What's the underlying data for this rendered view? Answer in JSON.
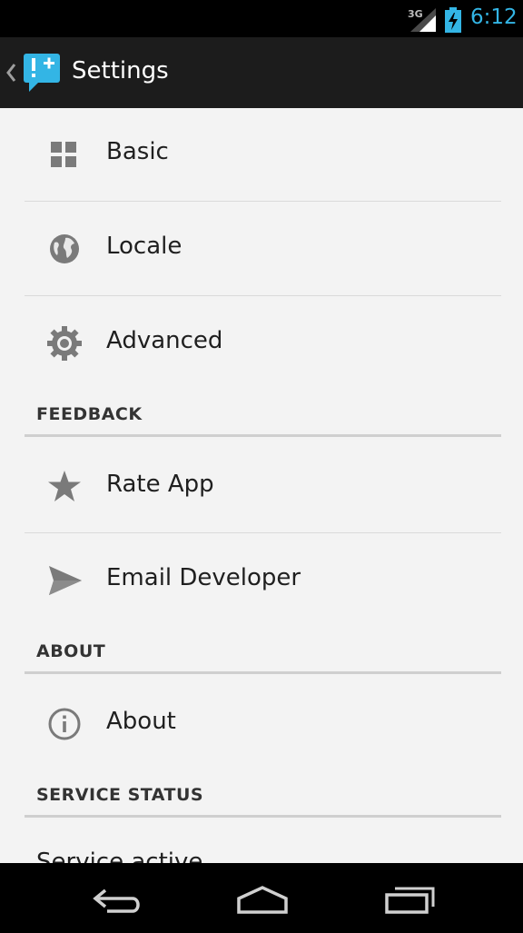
{
  "status_bar": {
    "network": "3G",
    "time": "6:12",
    "accent_color": "#33b5e5"
  },
  "action_bar": {
    "title": "Settings",
    "app_icon_glyph": "!+"
  },
  "settings": {
    "items": [
      {
        "label": "Basic",
        "icon": "grid-icon"
      },
      {
        "label": "Locale",
        "icon": "globe-icon"
      },
      {
        "label": "Advanced",
        "icon": "gear-icon"
      }
    ],
    "feedback": {
      "header": "FEEDBACK",
      "items": [
        {
          "label": "Rate App",
          "icon": "star-icon"
        },
        {
          "label": "Email Developer",
          "icon": "send-icon"
        }
      ]
    },
    "about": {
      "header": "ABOUT",
      "items": [
        {
          "label": "About",
          "icon": "info-icon"
        }
      ]
    },
    "service_status": {
      "header": "SERVICE STATUS",
      "partial_item": "Service active"
    }
  },
  "nav_bar": {
    "back": "back-icon",
    "home": "home-icon",
    "recents": "recents-icon"
  }
}
